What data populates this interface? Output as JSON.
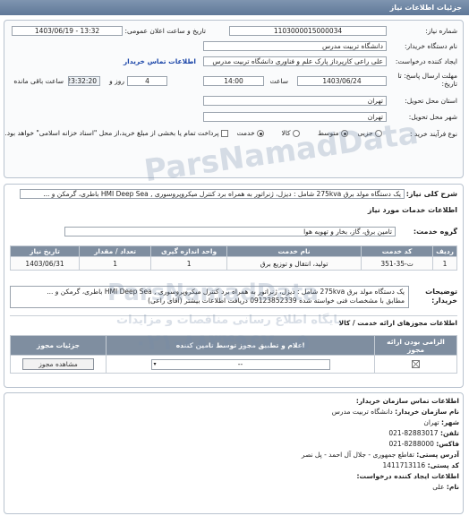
{
  "titlebar": "جزئیات اطلاعات نیاز",
  "need_number": {
    "label": "شماره نیاز:",
    "value": "1103000015000034"
  },
  "announce_date": {
    "label": "تاریخ و ساعت اعلان عمومی:",
    "value": "1403/06/19 - 13:32"
  },
  "buyer_name": {
    "label": "نام دستگاه خریدار:",
    "value": "دانشگاه تربیت مدرس"
  },
  "creator": {
    "label": "ایجاد کننده درخواست:",
    "value": "علی راعی کارپرداز پارک علم و فناوری دانشگاه تربیت مدرس",
    "link": "اطلاعات تماس خریدار"
  },
  "deadline": {
    "label": "مهلت ارسال پاسخ: تا تاریخ:",
    "date": "1403/06/24",
    "time_label": "ساعت",
    "time": "14:00",
    "days": "4",
    "days_label": "روز و",
    "remaining": "23:32:20",
    "remaining_label": "ساعت باقی مانده"
  },
  "province": {
    "label": "استان محل تحویل:",
    "value": "تهران"
  },
  "city": {
    "label": "شهر محل تحویل:",
    "value": "تهران"
  },
  "process": {
    "label": "نوع فرآیند خرید :",
    "options": [
      "جزیی",
      "متوسط"
    ],
    "checks": [
      "کالا",
      "خدمت"
    ],
    "payment": "پرداخت تمام یا بخشی از مبلغ خرید،از محل \"اسناد خزانه اسلامی\" خواهد بود."
  },
  "summary": {
    "label": "شرح کلی نیاز:",
    "value": "یک دستگاه مولد برق 275kva شامل : دیزل، ژنراتور به همراه برد کنترل میکروپروسوری , HMI Deep Sea باطری، گرمکن و ..."
  },
  "services_title": "اطلاعات خدمات مورد نیاز",
  "service_group": {
    "label": "گروه خدمت:",
    "value": "تامین برق، گاز، بخار و تهویه هوا"
  },
  "items_table": {
    "headers": [
      "ردیف",
      "کد خدمت",
      "نام خدمت",
      "واحد اندازه گیری",
      "تعداد / مقدار",
      "تاریخ نیاز"
    ],
    "rows": [
      [
        "1",
        "ت-35-351",
        "تولید، انتقال و توزیع برق",
        "1",
        "1",
        "1403/06/31"
      ]
    ]
  },
  "buyer_notes": {
    "label": "توضیحات خریدار:",
    "line1": "یک دستگاه مولد برق 275kva شامل : دیزل، ژنراتور به همراه برد کنترل میکروپروسوری , HMI Deep Sea باطری، گرمکن و ...",
    "line2": "مطابق با مشخصات فنی خواسته شده 09123852339 دریافت اطلاعات بیشتر (آقای راعی)"
  },
  "permits_title": "اطلاعات مجوزهای ارائه خدمت / کالا",
  "lic_table": {
    "headers": [
      "الزامی بودن ارائه مجوز",
      "اعلام و تطبیق مجوز توسط تامین کننده",
      "جزئیات مجوز"
    ],
    "row": {
      "required": "",
      "select": "--",
      "button": "مشاهده مجوز"
    }
  },
  "contact": {
    "title": "اطلاعات تماس سازمان خریدار:",
    "lines": [
      {
        "label": "نام سازمان خریدار:",
        "value": "دانشگاه تربیت مدرس"
      },
      {
        "label": "شهر:",
        "value": "تهران"
      },
      {
        "label": "تلفن:",
        "value": "82883017-021"
      },
      {
        "label": "فاکس:",
        "value": "8288000-021"
      },
      {
        "label": "آدرس پستی:",
        "value": "تقاطع جمهوری - جلال آل احمد - پل نصر"
      },
      {
        "label": "کد پستی:",
        "value": "1411713116"
      },
      {
        "label": "اطلاعات ایجاد کننده درخواست:",
        "value": ""
      },
      {
        "label": "نام:",
        "value": "علی"
      }
    ]
  },
  "watermarks": [
    "ParsNamadData",
    "پایگاه اطلاع رسانی مناقصات و مزایدات",
    "۰۲۱-۸۸۳۴۹۶۷۰-۵"
  ]
}
